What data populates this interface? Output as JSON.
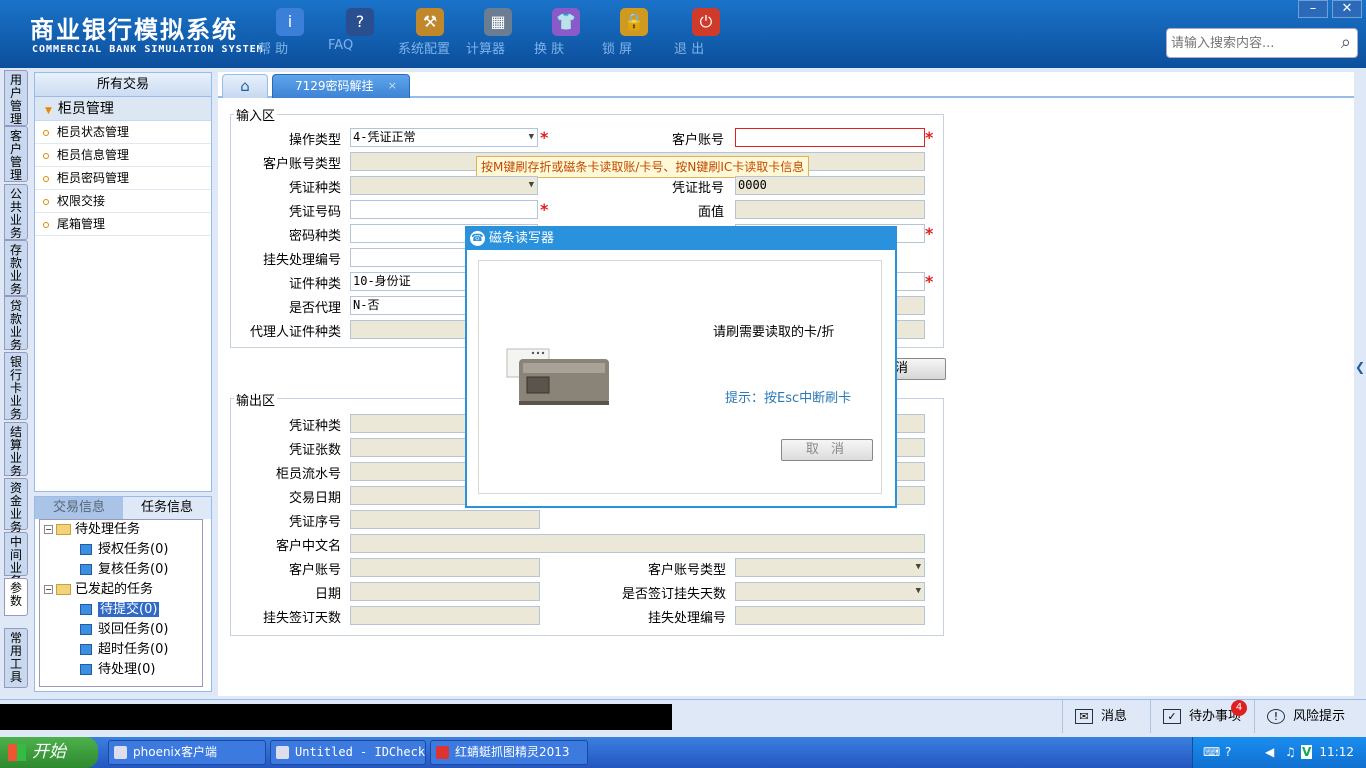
{
  "header": {
    "title_cn": "商业银行模拟系统",
    "title_en": "COMMERCIAL BANK SIMULATION SYSTEM",
    "toolbar": [
      {
        "label": "帮 助",
        "icon": "help-icon",
        "glyph": "i",
        "color": "#3b7fd8"
      },
      {
        "label": "FAQ",
        "icon": "faq-icon",
        "glyph": "?",
        "color": "#2a4f8f"
      },
      {
        "label": "系统配置",
        "icon": "toolbox-icon",
        "glyph": "⚒",
        "color": "#c0882a"
      },
      {
        "label": "计算器",
        "icon": "calculator-icon",
        "glyph": "▦",
        "color": "#6a7d92"
      },
      {
        "label": "换 肤",
        "icon": "shirt-icon",
        "glyph": "👕",
        "color": "#8a5ac8"
      },
      {
        "label": "锁 屏",
        "icon": "lock-icon",
        "glyph": "🔒",
        "color": "#d09a20"
      },
      {
        "label": "退 出",
        "icon": "power-icon",
        "glyph": "⏻",
        "color": "#d03a2a"
      }
    ],
    "search_placeholder": "请输入搜索内容...",
    "minimize": "–",
    "close": "✕"
  },
  "left_nav": [
    "用户管理",
    "客户管理",
    "公共业务",
    "存款业务",
    "贷款业务",
    "银行卡业务",
    "结算业务",
    "资金业务",
    "中间业务",
    "参数",
    "常用工具"
  ],
  "sidebar": {
    "title": "所有交易",
    "group": "柜员管理",
    "items": [
      "柜员状态管理",
      "柜员信息管理",
      "柜员密码管理",
      "权限交接",
      "尾箱管理"
    ]
  },
  "tasks": {
    "tabs": [
      "交易信息",
      "任务信息"
    ],
    "pending_root": "待处理任务",
    "pending": [
      "授权任务(0)",
      "复核任务(0)"
    ],
    "initiated_root": "已发起的任务",
    "initiated": [
      "待提交(0)",
      "驳回任务(0)",
      "超时任务(0)",
      "待处理(0)"
    ]
  },
  "tabs": {
    "home_icon": "home-icon",
    "current": "7129密码解挂",
    "close": "×"
  },
  "input": {
    "legend": "输入区",
    "op_type_label": "操作类型",
    "op_type_value": "4-凭证正常",
    "account_label": "客户账号",
    "account_value": "",
    "acct_type_label": "客户账号类型",
    "voucher_kind_label": "凭证种类",
    "voucher_batch_label": "凭证批号",
    "voucher_batch_value": "0000",
    "voucher_no_label": "凭证号码",
    "face_value_label": "面值",
    "pwd_kind_label": "密码种类",
    "loss_no_label": "挂失处理编号",
    "id_type_label": "证件种类",
    "id_type_value": "10-身份证",
    "agent_label": "是否代理",
    "agent_value": "N-否",
    "agent_id_label": "代理人证件种类",
    "tooltip": "按M键刷存折或磁条卡读取账/卡号、按N键刷IC卡读取卡信息",
    "partial_button": "消"
  },
  "output": {
    "legend": "输出区",
    "voucher_kind_label": "凭证种类",
    "voucher_count_label": "凭证张数",
    "teller_serial_label": "柜员流水号",
    "trade_date_label": "交易日期",
    "voucher_seq_label": "凭证序号",
    "cust_name_label": "客户中文名",
    "account_label": "客户账号",
    "acct_type_label": "客户账号类型",
    "date_label": "日期",
    "signed_days_flag_label": "是否签订挂失天数",
    "signed_days_label": "挂失签订天数",
    "loss_no_label": "挂失处理编号"
  },
  "dialog": {
    "title": "磁条读写器",
    "message": "请刷需要读取的卡/折",
    "hint": "提示：按Esc中断刷卡",
    "cancel": "取 消"
  },
  "statusbar": {
    "messages": "消息",
    "todo": "待办事项",
    "todo_count": "4",
    "risk": "风险提示"
  },
  "taskbar": {
    "start": "开始",
    "items": [
      "phoenix客户端",
      "Untitled - IDCheck",
      "红蜻蜓抓图精灵2013"
    ],
    "clock": "11:12"
  },
  "colors": {
    "header": "#1560b0",
    "accent": "#2a92dc",
    "required": "#e02020"
  }
}
